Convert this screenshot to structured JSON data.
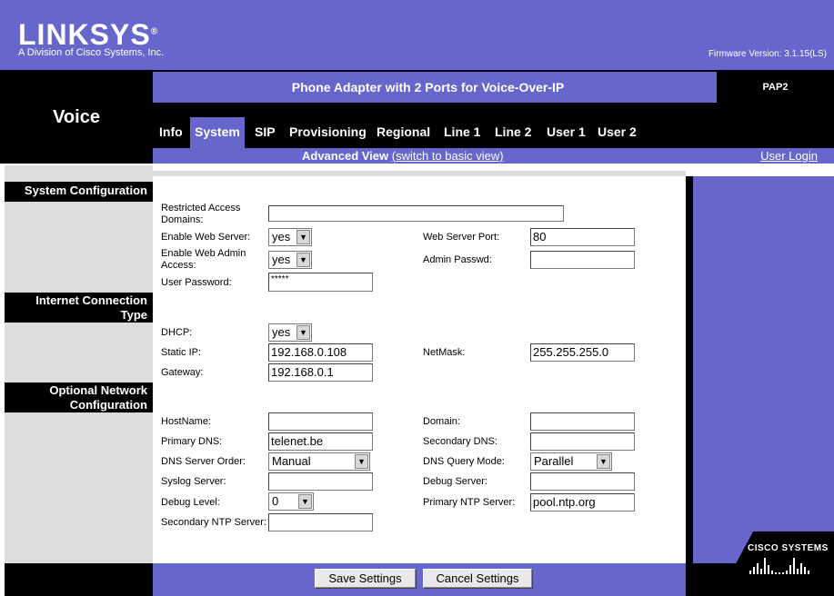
{
  "header": {
    "logo": "LINKSYS",
    "logo_mark": "®",
    "logo_sub": "A Division of Cisco Systems, Inc.",
    "firmware": "Firmware Version: 3.1.15(LS)",
    "product_title": "Phone Adapter with 2 Ports for Voice-Over-IP",
    "model": "PAP2",
    "section": "Voice"
  },
  "tabs": [
    {
      "label": "Info",
      "active": false
    },
    {
      "label": "System",
      "active": true
    },
    {
      "label": "SIP",
      "active": false
    },
    {
      "label": "Provisioning",
      "active": false
    },
    {
      "label": "Regional",
      "active": false
    },
    {
      "label": "Line 1",
      "active": false
    },
    {
      "label": "Line 2",
      "active": false
    },
    {
      "label": "User 1",
      "active": false
    },
    {
      "label": "User 2",
      "active": false
    }
  ],
  "view": {
    "prefix": "Advanced View",
    "link": "(switch to basic view)",
    "user_login": "User Login"
  },
  "sections": {
    "system_config": "System Configuration",
    "internet_conn_1": "Internet Connection",
    "internet_conn_2": "Type",
    "optional_net_1": "Optional Network",
    "optional_net_2": "Configuration"
  },
  "fields": {
    "restricted_access_label_1": "Restricted Access",
    "restricted_access_label_2": "Domains:",
    "restricted_access_value": "",
    "enable_web_server_label": "Enable Web Server:",
    "enable_web_server_value": "yes",
    "web_server_port_label": "Web Server Port:",
    "web_server_port_value": "80",
    "enable_web_admin_label_1": "Enable Web Admin",
    "enable_web_admin_label_2": "Access:",
    "enable_web_admin_value": "yes",
    "admin_passwd_label": "Admin Passwd:",
    "admin_passwd_value": "",
    "user_password_label": "User Password:",
    "user_password_value": "*****",
    "dhcp_label": "DHCP:",
    "dhcp_value": "yes",
    "static_ip_label": "Static IP:",
    "static_ip_value": "192.168.0.108",
    "netmask_label": "NetMask:",
    "netmask_value": "255.255.255.0",
    "gateway_label": "Gateway:",
    "gateway_value": "192.168.0.1",
    "hostname_label": "HostName:",
    "hostname_value": "",
    "domain_label": "Domain:",
    "domain_value": "",
    "primary_dns_label": "Primary DNS:",
    "primary_dns_value": "telenet.be",
    "secondary_dns_label": "Secondary DNS:",
    "secondary_dns_value": "",
    "dns_server_order_label": "DNS Server Order:",
    "dns_server_order_value": "Manual",
    "dns_query_mode_label": "DNS Query Mode:",
    "dns_query_mode_value": "Parallel",
    "syslog_server_label": "Syslog Server:",
    "syslog_server_value": "",
    "debug_server_label": "Debug Server:",
    "debug_server_value": "",
    "debug_level_label": "Debug Level:",
    "debug_level_value": "0",
    "primary_ntp_label": "Primary NTP Server:",
    "primary_ntp_value": "pool.ntp.org",
    "secondary_ntp_label": "Secondary NTP Server:",
    "secondary_ntp_value": ""
  },
  "buttons": {
    "save": "Save Settings",
    "cancel": "Cancel Settings"
  },
  "footer": {
    "cisco": "Cisco Systems"
  },
  "colors": {
    "brand_purple": "#6666cc",
    "black": "#000000",
    "gray_panel": "#dcdcdc"
  }
}
